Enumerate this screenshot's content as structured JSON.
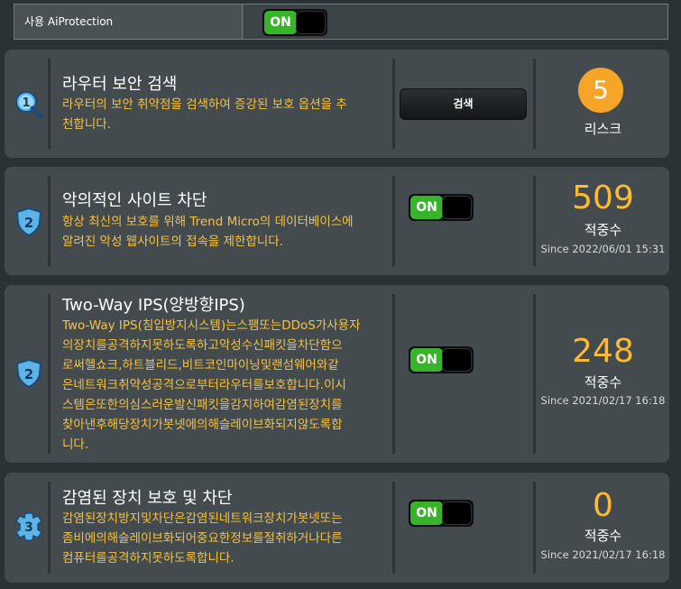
{
  "top": {
    "label": "사용 AiProtection",
    "toggle": "ON"
  },
  "cards": [
    {
      "badge": "1",
      "title": "라우터 보안 검색",
      "desc_lines": [
        "라우터의 보안 취약점을 검색하여 증강된 보호 옵션을 추",
        "천합니다."
      ],
      "button": "검색",
      "count": "5",
      "count_label": "리스크"
    },
    {
      "badge": "2",
      "title": "악의적인 사이트 차단",
      "desc_lines": [
        "항상 최신의 보호를 위해 Trend Micro의 데이터베이스에",
        "알려진 악성 웹사이트의 접속을 제한합니다."
      ],
      "toggle": "ON",
      "count": "509",
      "count_label": "적중수",
      "since": "Since 2022/06/01 15:31"
    },
    {
      "badge": "2",
      "title": "Two-Way IPS(양방향IPS)",
      "desc_lines": [
        "Two-Way IPS(침입방지시스템)는스팸또는DDoS가사용자",
        "의장치를공격하지못하도록하고악성수신패킷을차단함으",
        "로써헬쇼크,하트블리드,비트코인마이닝및랜섬웨어와같",
        "은네트워크취약성공격으로부터라우터를보호합니다.이시",
        "스템은또한의심스러운발신패킷을감지하여감염된장치를",
        "찾아낸후해당장치가봇넷에의해슬레이브화되지않도록합",
        "니다."
      ],
      "toggle": "ON",
      "count": "248",
      "count_label": "적중수",
      "since": "Since 2021/02/17 16:18"
    },
    {
      "badge": "3",
      "title": "감염된 장치 보호 및 차단",
      "desc_lines": [
        "감염된장치방지및차단은감염된네트워크장치가봇넷또는",
        "좀비에의해슬레이브화되어중요한정보를절취하거나다른",
        "컴퓨터를공격하지못하도록합니다."
      ],
      "toggle": "ON",
      "count": "0",
      "count_label": "적중수",
      "since": "Since 2021/02/17 16:18"
    }
  ]
}
